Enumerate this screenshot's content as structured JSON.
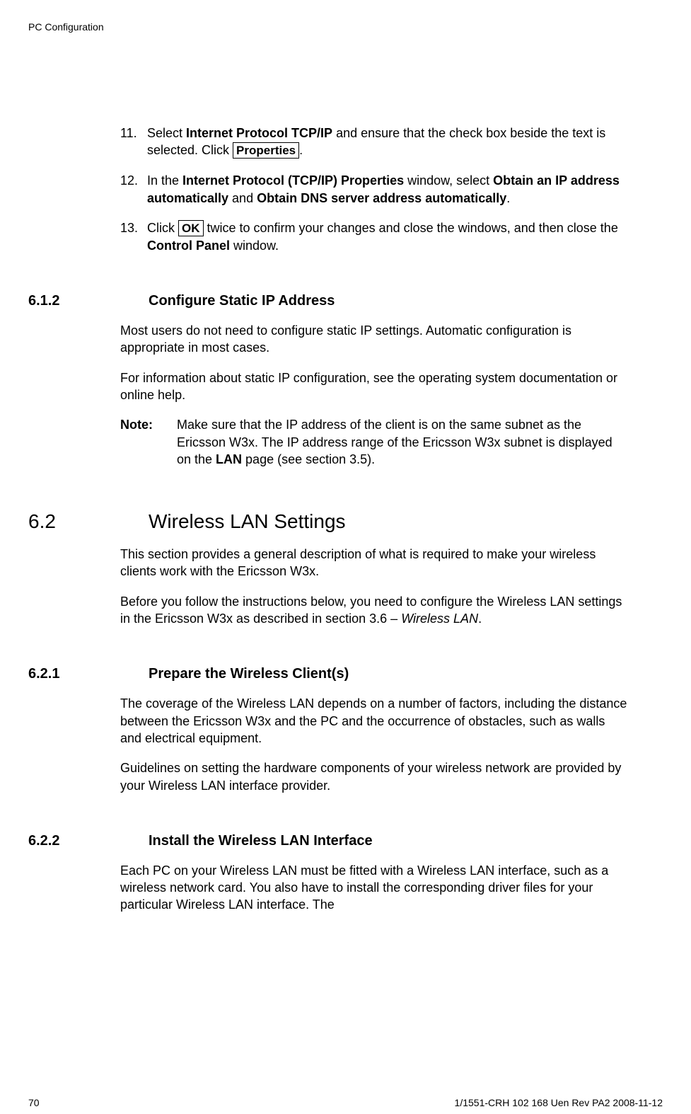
{
  "header": "PC Configuration",
  "step11": {
    "num": "11.",
    "textA": "Select ",
    "bold1": "Internet Protocol TCP/IP",
    "textB": " and ensure that the check box beside the text is selected. Click ",
    "button": "Properties",
    "textC": "."
  },
  "step12": {
    "num": "12.",
    "textA": "In the ",
    "bold1": "Internet Protocol (TCP/IP) Properties",
    "textB": " window, select ",
    "bold2": "Obtain an IP address automatically",
    "textC": " and ",
    "bold3": "Obtain DNS server address automatically",
    "textD": "."
  },
  "step13": {
    "num": "13.",
    "textA": "Click ",
    "button": "OK",
    "textB": " twice to confirm your changes and close the windows, and then close the ",
    "bold1": "Control Panel",
    "textC": " window."
  },
  "sec612": {
    "num": "6.1.2",
    "title": "Configure Static IP Address",
    "para1": "Most users do not need to configure static IP settings. Automatic configuration is appropriate in most cases.",
    "para2": "For information about static IP configuration, see the operating system documentation or online help.",
    "noteLabel": "Note:",
    "noteA": "Make sure that the IP address of the client is on the same subnet as the Ericsson W3x. The IP address range of the Ericsson W3x subnet is displayed on the ",
    "noteBold": "LAN",
    "noteB": " page (see section 3.5)."
  },
  "sec62": {
    "num": "6.2",
    "title": "Wireless LAN Settings",
    "para1": "This section provides a general description of what is required to make your wireless clients work with the Ericsson W3x.",
    "para2a": "Before you follow the instructions below, you need to configure the Wireless LAN settings in the Ericsson W3x as described in section 3.6 – ",
    "para2italic": "Wireless LAN",
    "para2b": "."
  },
  "sec621": {
    "num": "6.2.1",
    "title": "Prepare the Wireless Client(s)",
    "para1": "The coverage of the Wireless LAN depends on a number of factors, including the distance between the Ericsson W3x and the PC and the occurrence of obstacles, such as walls and electrical equipment.",
    "para2": "Guidelines on setting the hardware components of your wireless network are provided by your Wireless LAN interface provider."
  },
  "sec622": {
    "num": "6.2.2",
    "title": "Install the Wireless LAN Interface",
    "para1": "Each PC on your Wireless LAN must be fitted with a Wireless LAN interface, such as a wireless network card. You also have to install the corresponding driver files for your particular Wireless LAN interface. The"
  },
  "footer": {
    "pageNum": "70",
    "docId": "1/1551-CRH 102 168 Uen Rev PA2  2008-11-12"
  }
}
